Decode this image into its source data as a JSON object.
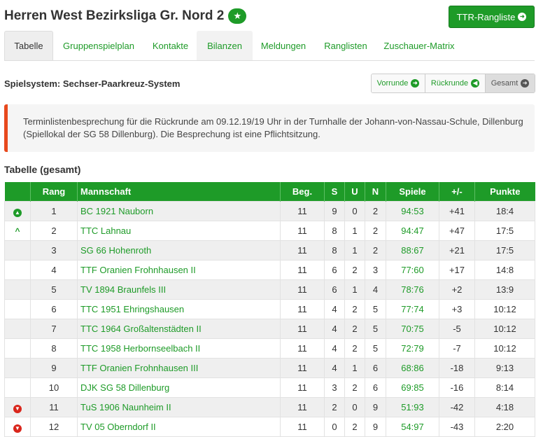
{
  "header": {
    "title": "Herren West Bezirksliga Gr. Nord 2",
    "star_icon": "star-icon",
    "ttr_button": "TTR-Rangliste"
  },
  "tabs": [
    "Tabelle",
    "Gruppenspielplan",
    "Kontakte",
    "Bilanzen",
    "Meldungen",
    "Ranglisten",
    "Zuschauer-Matrix"
  ],
  "active_tab": "Tabelle",
  "spielsystem": "Spielsystem: Sechser-Paarkreuz-System",
  "round_buttons": [
    "Vorrunde",
    "Rückrunde",
    "Gesamt"
  ],
  "active_round": "Gesamt",
  "notice": "Terminlistenbesprechung für die Rückrunde am 09.12.19/19 Uhr in der Turnhalle der Johann-von-Nassau-Schule, Dillenburg (Spiellokal der SG 58 Dillenburg). Die Besprechung ist eine Pflichtsitzung.",
  "table_title": "Tabelle (gesamt)",
  "columns": [
    "",
    "Rang",
    "Mannschaft",
    "Beg.",
    "S",
    "U",
    "N",
    "Spiele",
    "+/-",
    "Punkte"
  ],
  "rows": [
    {
      "ind": "up",
      "rang": "1",
      "team": "BC 1921 Nauborn",
      "beg": "11",
      "s": "9",
      "u": "0",
      "n": "2",
      "spiele": "94:53",
      "diff": "+41",
      "punkte": "18:4"
    },
    {
      "ind": "caret",
      "rang": "2",
      "team": "TTC Lahnau",
      "beg": "11",
      "s": "8",
      "u": "1",
      "n": "2",
      "spiele": "94:47",
      "diff": "+47",
      "punkte": "17:5"
    },
    {
      "ind": "",
      "rang": "3",
      "team": "SG 66 Hohenroth",
      "beg": "11",
      "s": "8",
      "u": "1",
      "n": "2",
      "spiele": "88:67",
      "diff": "+21",
      "punkte": "17:5"
    },
    {
      "ind": "",
      "rang": "4",
      "team": "TTF Oranien Frohnhausen II",
      "beg": "11",
      "s": "6",
      "u": "2",
      "n": "3",
      "spiele": "77:60",
      "diff": "+17",
      "punkte": "14:8"
    },
    {
      "ind": "",
      "rang": "5",
      "team": "TV 1894 Braunfels III",
      "beg": "11",
      "s": "6",
      "u": "1",
      "n": "4",
      "spiele": "78:76",
      "diff": "+2",
      "punkte": "13:9"
    },
    {
      "ind": "",
      "rang": "6",
      "team": "TTC 1951 Ehringshausen",
      "beg": "11",
      "s": "4",
      "u": "2",
      "n": "5",
      "spiele": "77:74",
      "diff": "+3",
      "punkte": "10:12"
    },
    {
      "ind": "",
      "rang": "7",
      "team": "TTC 1964 Großaltenstädten II",
      "beg": "11",
      "s": "4",
      "u": "2",
      "n": "5",
      "spiele": "70:75",
      "diff": "-5",
      "punkte": "10:12"
    },
    {
      "ind": "",
      "rang": "8",
      "team": "TTC 1958 Herbornseelbach II",
      "beg": "11",
      "s": "4",
      "u": "2",
      "n": "5",
      "spiele": "72:79",
      "diff": "-7",
      "punkte": "10:12"
    },
    {
      "ind": "",
      "rang": "9",
      "team": "TTF Oranien Frohnhausen III",
      "beg": "11",
      "s": "4",
      "u": "1",
      "n": "6",
      "spiele": "68:86",
      "diff": "-18",
      "punkte": "9:13"
    },
    {
      "ind": "",
      "rang": "10",
      "team": "DJK SG 58 Dillenburg",
      "beg": "11",
      "s": "3",
      "u": "2",
      "n": "6",
      "spiele": "69:85",
      "diff": "-16",
      "punkte": "8:14"
    },
    {
      "ind": "down",
      "rang": "11",
      "team": "TuS 1906 Naunheim II",
      "beg": "11",
      "s": "2",
      "u": "0",
      "n": "9",
      "spiele": "51:93",
      "diff": "-42",
      "punkte": "4:18"
    },
    {
      "ind": "down",
      "rang": "12",
      "team": "TV 05 Oberndorf II",
      "beg": "11",
      "s": "0",
      "u": "2",
      "n": "9",
      "spiele": "54:97",
      "diff": "-43",
      "punkte": "2:20"
    }
  ],
  "colors": {
    "accent": "#1e9b28",
    "danger": "#d9261c",
    "notice_border": "#e8491d"
  }
}
